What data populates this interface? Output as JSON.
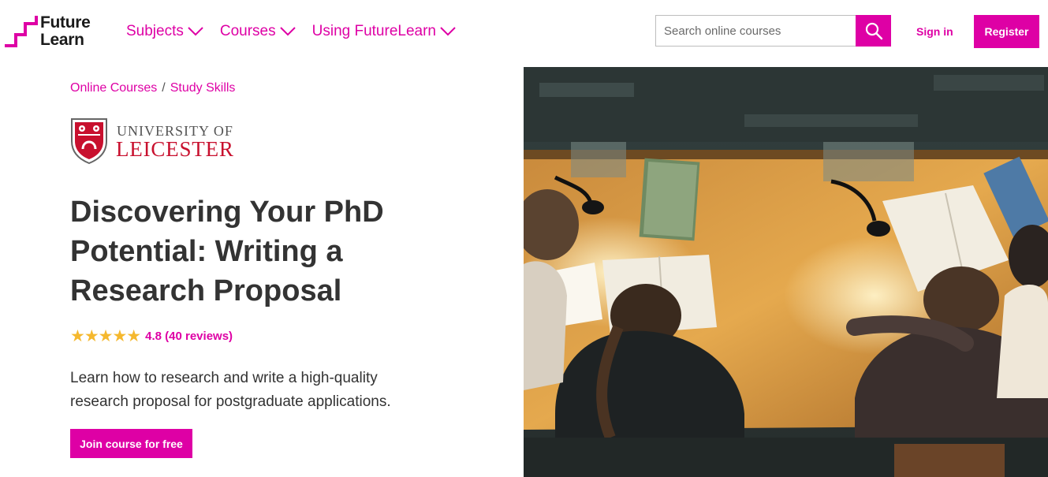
{
  "header": {
    "logo_line1": "Future",
    "logo_line2": "Learn",
    "nav": [
      {
        "label": "Subjects"
      },
      {
        "label": "Courses"
      },
      {
        "label": "Using FutureLearn"
      }
    ],
    "search_placeholder": "Search online courses",
    "signin_label": "Sign in",
    "register_label": "Register"
  },
  "breadcrumb": {
    "items": [
      "Online Courses",
      "Study Skills"
    ],
    "separator": "/"
  },
  "university": {
    "line1": "UNIVERSITY OF",
    "line2": "LEICESTER"
  },
  "course": {
    "title": "Discovering Your PhD Potential: Writing a Research Proposal",
    "stars": "★★★★★",
    "rating_text": "4.8 (40 reviews)",
    "description": "Learn how to research and write a high-quality research proposal for postgraduate applications.",
    "join_label": "Join course for free"
  },
  "colors": {
    "accent": "#de00a5",
    "star": "#f5b82e",
    "leicester_red": "#c8102e"
  },
  "icons": [
    "futurelearn-logo",
    "chevron-down-icon",
    "search-icon",
    "leicester-shield-icon"
  ]
}
